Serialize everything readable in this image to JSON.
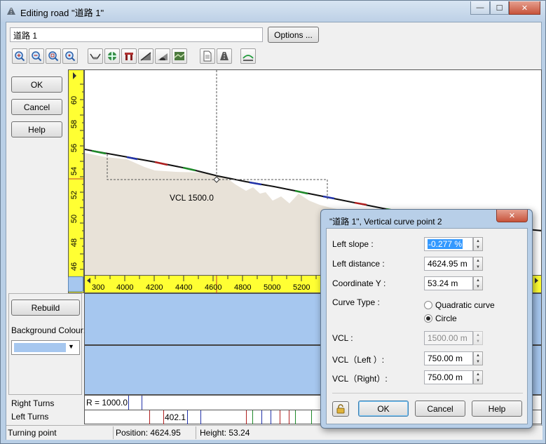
{
  "window": {
    "title": "Editing road \"道路 1\"",
    "controls": {
      "minimize": "—",
      "maximize": "☐",
      "close": "✕"
    }
  },
  "road_name_value": "道路 1",
  "options_label": "Options ...",
  "toolbar_icons": [
    "zoom-in-icon",
    "zoom-out-icon",
    "zoom-window-icon",
    "zoom-fit-icon",
    "cross-section-icon",
    "junction-icon",
    "bridge-icon",
    "slope-icon",
    "tunnel-icon",
    "terrain-icon",
    "document-icon",
    "road-icon",
    "profile-line-icon"
  ],
  "side_buttons": {
    "ok": "OK",
    "cancel": "Cancel",
    "help": "Help"
  },
  "profile": {
    "vcl_label": "VCL  1500.0",
    "y_ticks": [
      "60",
      "58",
      "56",
      "54",
      "52",
      "50",
      "48",
      "46"
    ],
    "x_ticks": [
      "300",
      "4000",
      "4200",
      "4400",
      "4600",
      "4800",
      "5000",
      "5200"
    ]
  },
  "lower_panel": {
    "rebuild_label": "Rebuild",
    "background_colour_label": "Background Colour:",
    "background_colour_value": "#a6c7ef"
  },
  "turns": {
    "right_label": "Right Turns",
    "left_label": "Left Turns",
    "right_value": "R = 1000.0",
    "left_value": "402.1"
  },
  "status_bar": {
    "mode": "Turning point",
    "position": "Position: 4624.95",
    "height": "Height: 53.24"
  },
  "dialog": {
    "title": "\"道路 1\", Vertical curve point 2",
    "close_label": "✕",
    "left_slope_label": "Left slope :",
    "left_slope_value": "-0.277 %",
    "left_distance_label": "Left distance :",
    "left_distance_value": "4624.95 m",
    "coordinate_y_label": "Coordinate Y :",
    "coordinate_y_value": "53.24 m",
    "curve_type_label": "Curve Type :",
    "curve_type_options": [
      "Quadratic curve",
      "Circle"
    ],
    "curve_type_selected": "Circle",
    "vcl_label": "VCL :",
    "vcl_value": "1500.00 m",
    "vcl_left_label": "VCL（Left ）:",
    "vcl_left_value": "750.00 m",
    "vcl_right_label": "VCL（Right）:",
    "vcl_right_value": "750.00 m",
    "ok_label": "OK",
    "cancel_label": "Cancel",
    "help_label": "Help"
  }
}
